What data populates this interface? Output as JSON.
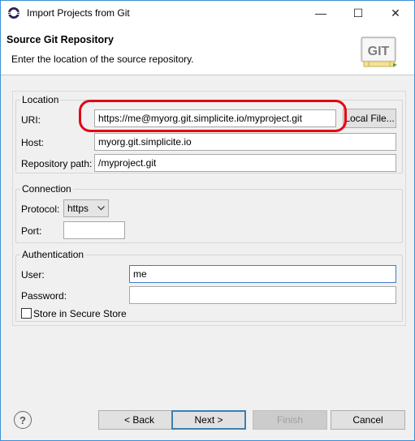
{
  "window": {
    "title": "Import Projects from Git",
    "minimize": "—",
    "maximize": "☐",
    "close": "✕"
  },
  "header": {
    "title": "Source Git Repository",
    "description": "Enter the location of the source repository.",
    "logo_text": "GIT"
  },
  "location": {
    "legend": "Location",
    "uri_label": "URI:",
    "uri_value": "https://me@myorg.git.simplicite.io/myproject.git",
    "local_file_button": "Local File...",
    "host_label": "Host:",
    "host_value": "myorg.git.simplicite.io",
    "repo_path_label": "Repository path:",
    "repo_path_value": "/myproject.git"
  },
  "connection": {
    "legend": "Connection",
    "protocol_label": "Protocol:",
    "protocol_value": "https",
    "port_label": "Port:",
    "port_value": ""
  },
  "authentication": {
    "legend": "Authentication",
    "user_label": "User:",
    "user_value": "me",
    "password_label": "Password:",
    "password_value": "",
    "store_label": "Store in Secure Store"
  },
  "footer": {
    "help": "?",
    "back_button": "< Back",
    "next_button": "Next >",
    "finish_button": "Finish",
    "cancel_button": "Cancel"
  },
  "icons": {
    "app": "eclipse-icon",
    "help": "help-icon",
    "dropdown": "chevron-down-icon"
  },
  "colors": {
    "highlight": "#e30613",
    "focus_border": "#3f7cc8"
  }
}
